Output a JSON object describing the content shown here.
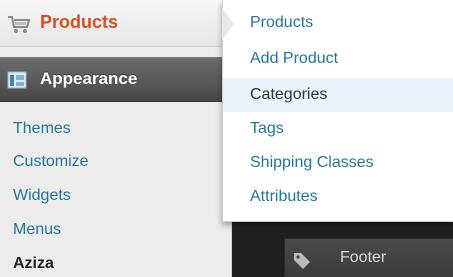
{
  "menu": {
    "products_label": "Products",
    "appearance_label": "Appearance",
    "appearance_submenu": [
      {
        "label": "Themes"
      },
      {
        "label": "Customize"
      },
      {
        "label": "Widgets"
      },
      {
        "label": "Menus"
      },
      {
        "label": "Aziza"
      }
    ]
  },
  "flyout": {
    "items": [
      {
        "label": "Products"
      },
      {
        "label": "Add Product"
      },
      {
        "label": "Categories"
      },
      {
        "label": "Tags"
      },
      {
        "label": "Shipping Classes"
      },
      {
        "label": "Attributes"
      }
    ],
    "hovered": "Categories"
  },
  "widget": {
    "label": "Footer",
    "icon": "tag-icon"
  },
  "colors": {
    "products_accent": "#d54e21",
    "link": "#21759b",
    "hover_bg": "#eaf2fa",
    "dark_bg": "#1f1f1f"
  }
}
